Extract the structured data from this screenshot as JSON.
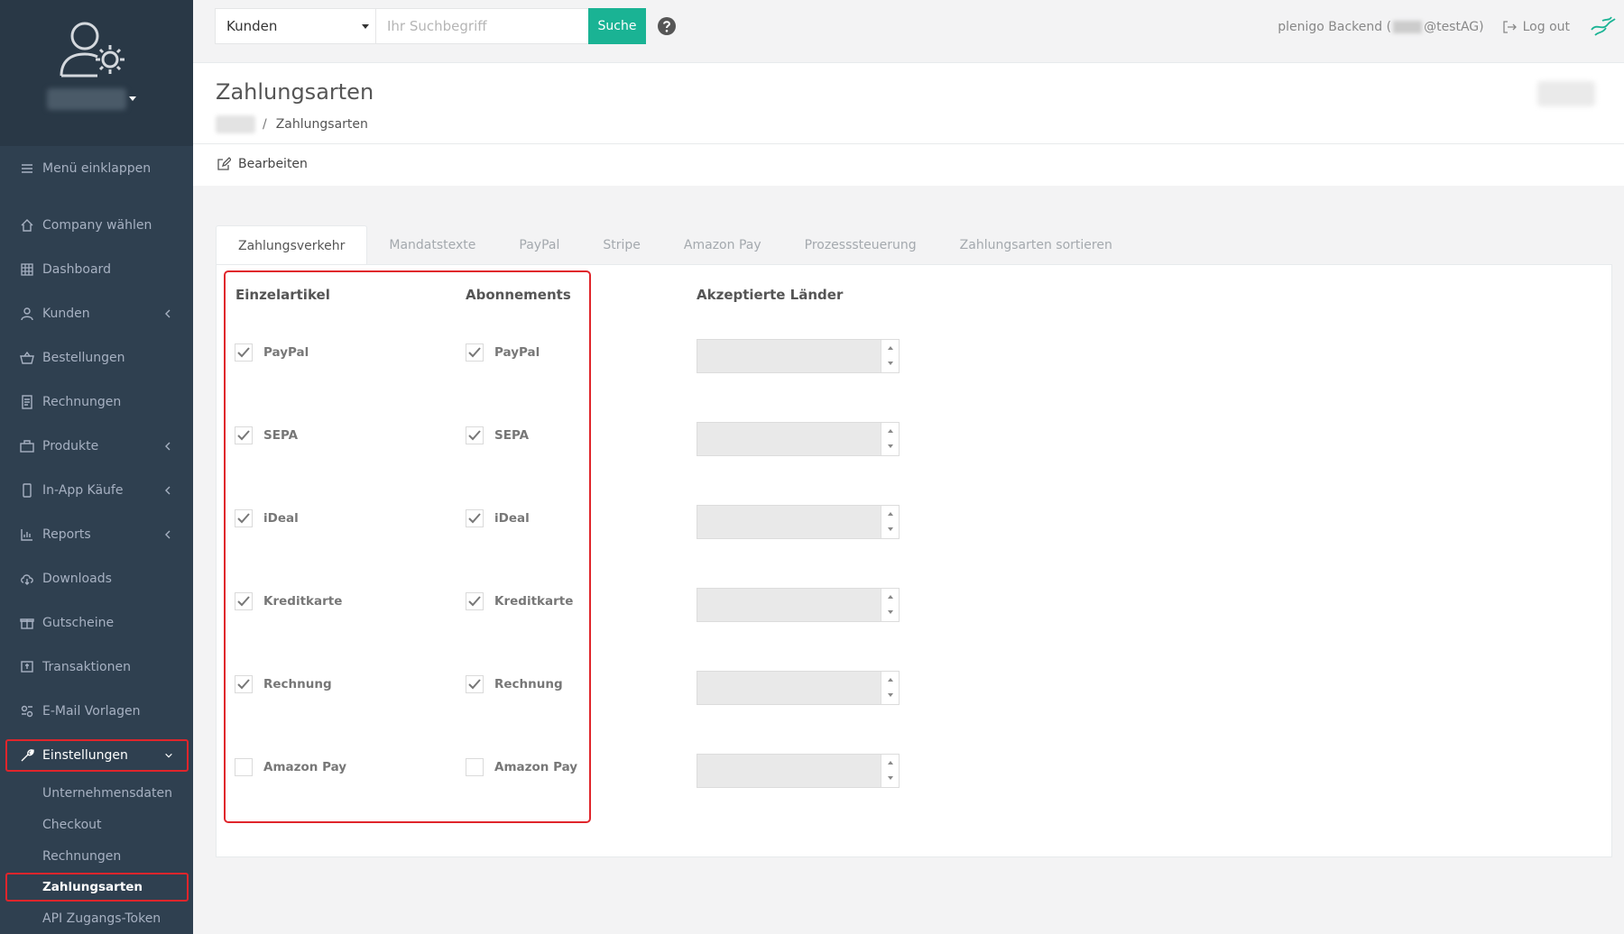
{
  "sidebar": {
    "items": [
      {
        "label": "Menü einklappen",
        "icon": "menu-icon"
      },
      {
        "label": "Company wählen",
        "icon": "home-icon"
      },
      {
        "label": "Dashboard",
        "icon": "grid-icon"
      },
      {
        "label": "Kunden",
        "icon": "user-icon"
      },
      {
        "label": "Bestellungen",
        "icon": "basket-icon"
      },
      {
        "label": "Rechnungen",
        "icon": "invoice-icon"
      },
      {
        "label": "Produkte",
        "icon": "products-icon"
      },
      {
        "label": "In-App Käufe",
        "icon": "mobile-icon"
      },
      {
        "label": "Reports",
        "icon": "chart-icon"
      },
      {
        "label": "Downloads",
        "icon": "cloud-download-icon"
      },
      {
        "label": "Gutscheine",
        "icon": "gift-icon"
      },
      {
        "label": "Transaktionen",
        "icon": "transaction-icon"
      },
      {
        "label": "E-Mail Vorlagen",
        "icon": "email-template-icon"
      },
      {
        "label": "Einstellungen",
        "icon": "wrench-icon"
      }
    ],
    "subitems": [
      {
        "label": "Unternehmensdaten"
      },
      {
        "label": "Checkout"
      },
      {
        "label": "Rechnungen"
      },
      {
        "label": "Zahlungsarten"
      },
      {
        "label": "API Zugangs-Token"
      }
    ]
  },
  "topbar": {
    "search_scope": "Kunden",
    "search_placeholder": "Ihr Suchbegriff",
    "search_button": "Suche",
    "user_prefix": "plenigo Backend (",
    "user_suffix": "@testAG)",
    "logout": "Log out"
  },
  "page": {
    "title": "Zahlungsarten",
    "breadcrumb_current": "Zahlungsarten",
    "edit_label": "Bearbeiten"
  },
  "tabs": [
    {
      "label": "Zahlungsverkehr",
      "active": true
    },
    {
      "label": "Mandatstexte",
      "active": false
    },
    {
      "label": "PayPal",
      "active": false
    },
    {
      "label": "Stripe",
      "active": false
    },
    {
      "label": "Amazon Pay",
      "active": false
    },
    {
      "label": "Prozesssteuerung",
      "active": false
    },
    {
      "label": "Zahlungsarten sortieren",
      "active": false
    }
  ],
  "payments": {
    "col_single": "Einzelartikel",
    "col_subscription": "Abonnements",
    "col_countries": "Akzeptierte Länder",
    "methods": [
      {
        "label": "PayPal",
        "single": true,
        "subscription": true
      },
      {
        "label": "SEPA",
        "single": true,
        "subscription": true
      },
      {
        "label": "iDeal",
        "single": true,
        "subscription": true
      },
      {
        "label": "Kreditkarte",
        "single": true,
        "subscription": true
      },
      {
        "label": "Rechnung",
        "single": true,
        "subscription": true
      },
      {
        "label": "Amazon Pay",
        "single": false,
        "subscription": false
      }
    ]
  },
  "colors": {
    "sidebar_bg": "#2f4050",
    "accent": "#1ab394",
    "highlight": "#e0252b"
  }
}
